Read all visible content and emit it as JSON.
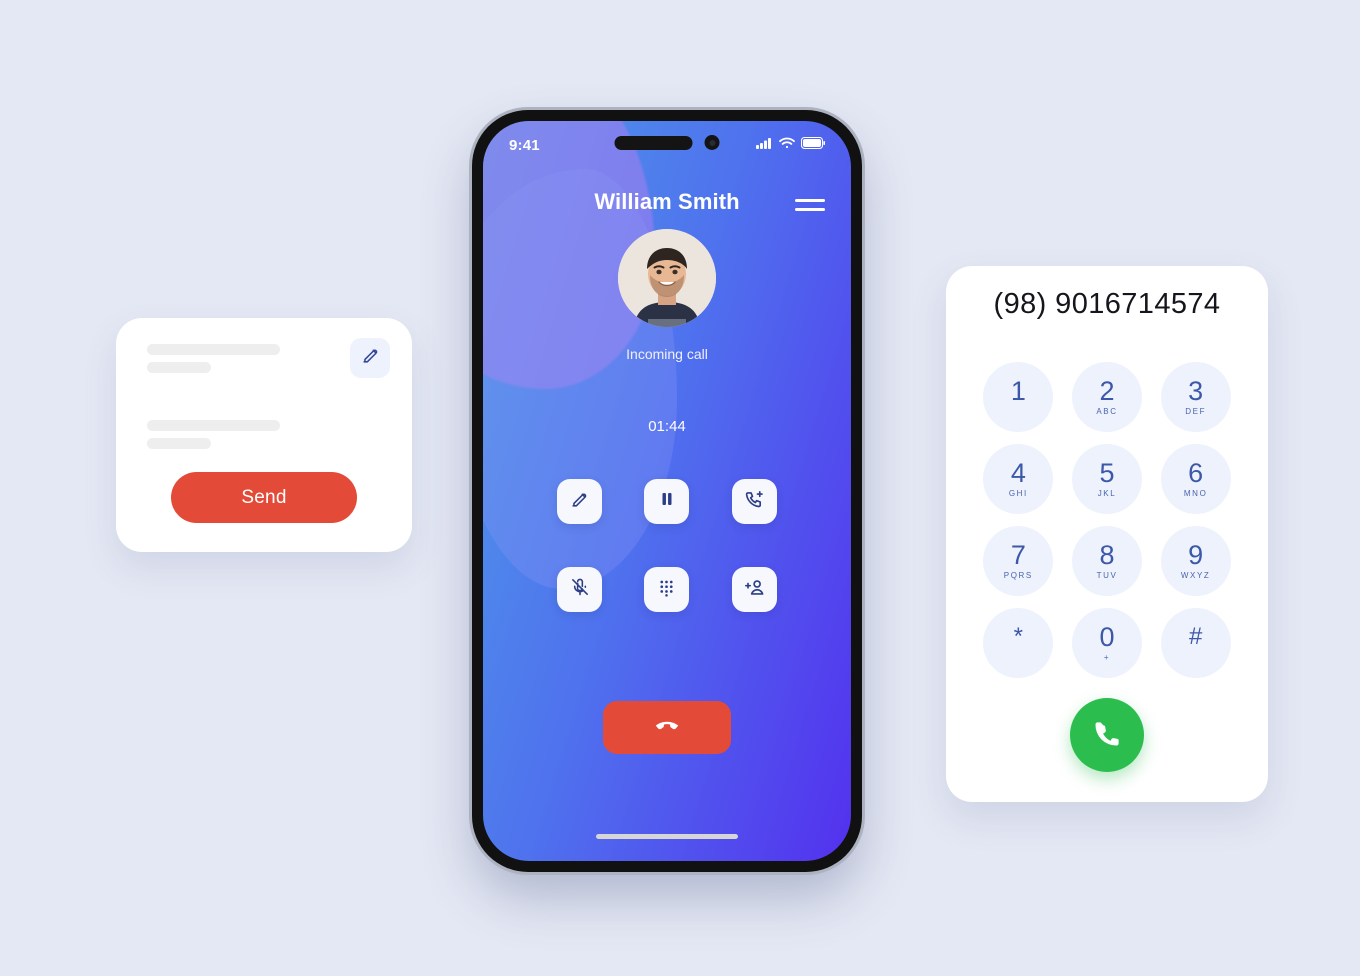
{
  "message_card": {
    "edit_icon": "pencil-icon",
    "send_label": "Send",
    "skeleton_lines": 4
  },
  "phone": {
    "status_bar": {
      "time": "9:41",
      "signal_icon": "signal-bars-icon",
      "wifi_icon": "wifi-icon",
      "battery_icon": "battery-icon"
    },
    "caller_name": "William Smith",
    "call_status": "Incoming call",
    "call_timer": "01:44",
    "menu_icon": "hamburger-menu-icon",
    "avatar_alt": "caller-avatar",
    "actions": [
      {
        "name": "edit-note",
        "icon": "pencil-icon"
      },
      {
        "name": "hold",
        "icon": "pause-icon"
      },
      {
        "name": "add-call",
        "icon": "phone-plus-icon"
      },
      {
        "name": "mute",
        "icon": "mic-off-icon"
      },
      {
        "name": "keypad",
        "icon": "dialpad-icon"
      },
      {
        "name": "add-person",
        "icon": "person-plus-icon"
      }
    ],
    "end_call_icon": "phone-hangup-icon",
    "home_indicator": "home-indicator"
  },
  "dialpad": {
    "number": "(98) 9016714574",
    "keys": [
      {
        "digit": "1",
        "letters": ""
      },
      {
        "digit": "2",
        "letters": "ABC"
      },
      {
        "digit": "3",
        "letters": "DEF"
      },
      {
        "digit": "4",
        "letters": "GHI"
      },
      {
        "digit": "5",
        "letters": "JKL"
      },
      {
        "digit": "6",
        "letters": "MNO"
      },
      {
        "digit": "7",
        "letters": "PQRS"
      },
      {
        "digit": "8",
        "letters": "TUV"
      },
      {
        "digit": "9",
        "letters": "WXYZ"
      },
      {
        "digit": "*",
        "letters": ""
      },
      {
        "digit": "0",
        "letters": "+"
      },
      {
        "digit": "#",
        "letters": ""
      }
    ],
    "call_icon": "phone-icon"
  },
  "colors": {
    "page_background": "#e4e8f4",
    "gradient_start": "#4e9ae8",
    "gradient_end": "#5331ee",
    "accent_red": "#e34b38",
    "accent_green": "#2cbd4f",
    "key_blue": "#3d58a8",
    "key_background": "#edf2fd"
  }
}
